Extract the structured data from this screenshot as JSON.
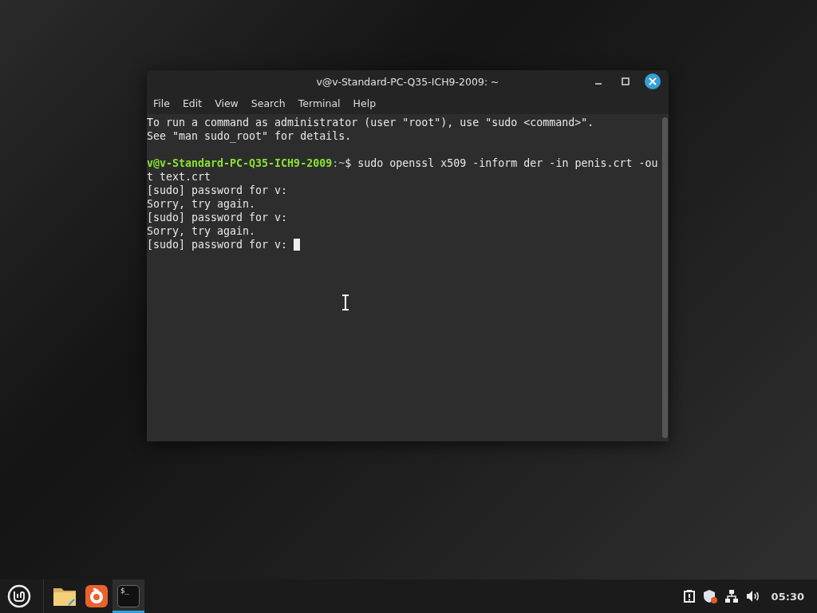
{
  "window": {
    "title": "v@v-Standard-PC-Q35-ICH9-2009: ~"
  },
  "menu": [
    "File",
    "Edit",
    "View",
    "Search",
    "Terminal",
    "Help"
  ],
  "terminal": {
    "lines": [
      {
        "kind": "text",
        "text": "To run a command as administrator (user \"root\"), use \"sudo <command>\"."
      },
      {
        "kind": "text",
        "text": "See \"man sudo_root\" for details."
      },
      {
        "kind": "blank"
      },
      {
        "kind": "prompt",
        "user": "v@v-Standard-PC-Q35-ICH9-2009",
        "path": ":~",
        "symbol": "$",
        "command": " sudo openssl x509 -inform der -in penis.crt -out text.crt"
      },
      {
        "kind": "text",
        "text": "[sudo] password for v:"
      },
      {
        "kind": "text",
        "text": "Sorry, try again."
      },
      {
        "kind": "text",
        "text": "[sudo] password for v:"
      },
      {
        "kind": "text",
        "text": "Sorry, try again."
      },
      {
        "kind": "text",
        "text": "[sudo] password for v: "
      }
    ],
    "cursor": true
  },
  "taskbar": {
    "launchers": [
      {
        "kind": "files",
        "selected": false
      },
      {
        "kind": "browser",
        "selected": false
      },
      {
        "kind": "terminal",
        "selected": true,
        "glyph": "$_"
      }
    ],
    "clock": "05:30"
  }
}
